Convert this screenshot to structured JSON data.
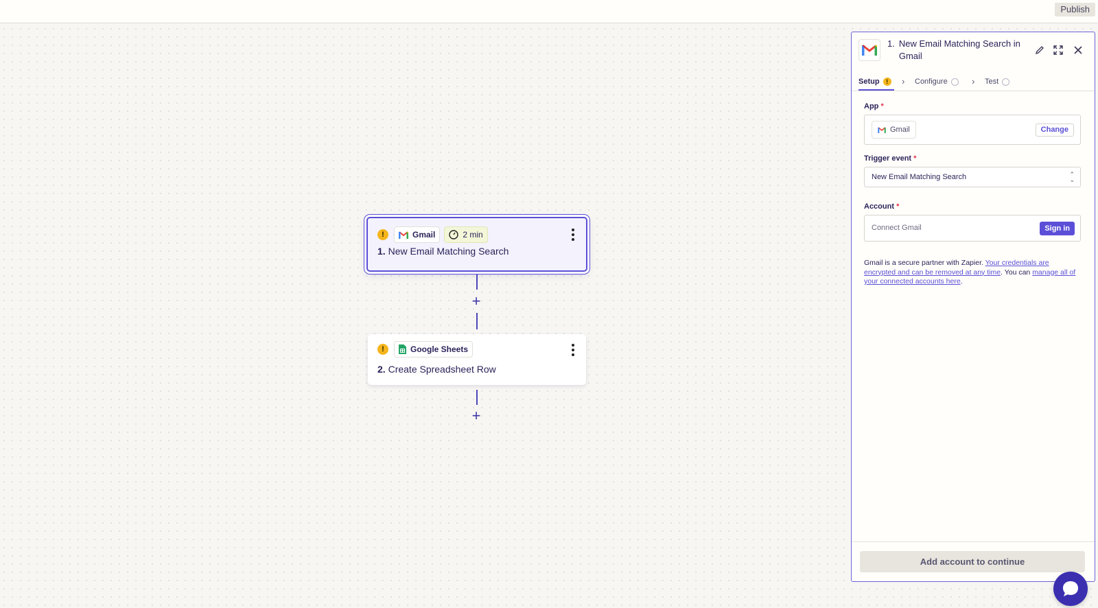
{
  "topbar": {
    "publish_label": "Publish"
  },
  "canvas": {
    "steps": [
      {
        "app": "Gmail",
        "time_badge": "2 min",
        "number": "1.",
        "title": "New Email Matching Search"
      },
      {
        "app": "Google Sheets",
        "number": "2.",
        "title": "Create Spreadsheet Row"
      }
    ],
    "warning_glyph": "!",
    "add_step_glyph": "+"
  },
  "panel": {
    "step_number": "1.",
    "title": "New Email Matching Search in Gmail",
    "tabs": [
      {
        "label": "Setup",
        "state": "warning"
      },
      {
        "label": "Configure",
        "state": "pending"
      },
      {
        "label": "Test",
        "state": "pending"
      }
    ],
    "app_field": {
      "label": "App",
      "required_mark": "*",
      "value": "Gmail",
      "change_label": "Change"
    },
    "trigger_field": {
      "label": "Trigger event",
      "required_mark": "*",
      "value": "New Email Matching Search"
    },
    "account_field": {
      "label": "Account",
      "required_mark": "*",
      "placeholder": "Connect Gmail",
      "signin_label": "Sign in"
    },
    "note": {
      "app": "Gmail",
      "text1": " is a secure partner with Zapier. ",
      "link1": "Your credentials are encrypted and can be removed at any time",
      "text2": ". You can ",
      "link2": "manage all of your connected accounts here",
      "text3": "."
    },
    "continue_label": "Add account to continue"
  },
  "colors": {
    "accent": "#5a4fd6",
    "warning": "#f5b51c",
    "required": "#e0334a",
    "chat": "#3b2fb0"
  }
}
